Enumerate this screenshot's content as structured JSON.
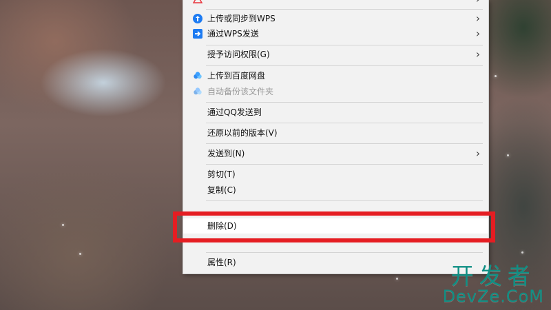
{
  "menu": {
    "items": [
      {
        "id": "top_partial",
        "label": "",
        "icon": "warning-triangle-icon",
        "arrow": true
      },
      {
        "id": "upload_sync_wps",
        "label": "上传或同步到WPS",
        "icon": "cloud-upload-icon",
        "arrow": true
      },
      {
        "id": "send_via_wps",
        "label": "通过WPS发送",
        "icon": "wps-send-icon",
        "arrow": true
      },
      {
        "id": "grant_access",
        "label": "授予访问权限(G)",
        "icon": "",
        "arrow": true
      },
      {
        "id": "upload_baidu",
        "label": "上传到百度网盘",
        "icon": "baidu-cloud-icon",
        "arrow": false
      },
      {
        "id": "auto_backup",
        "label": "自动备份该文件夹",
        "icon": "baidu-cloud-icon",
        "arrow": false
      },
      {
        "id": "send_qq",
        "label": "通过QQ发送到",
        "icon": "",
        "arrow": false
      },
      {
        "id": "restore_previous",
        "label": "还原以前的版本(V)",
        "icon": "",
        "arrow": false
      },
      {
        "id": "send_to",
        "label": "发送到(N)",
        "icon": "",
        "arrow": true
      },
      {
        "id": "cut",
        "label": "剪切(T)",
        "icon": "",
        "arrow": false
      },
      {
        "id": "copy",
        "label": "复制(C)",
        "icon": "",
        "arrow": false
      },
      {
        "id": "create_shortcut",
        "label": "",
        "icon": "",
        "arrow": false
      },
      {
        "id": "delete",
        "label": "删除(D)",
        "icon": "",
        "arrow": false
      },
      {
        "id": "rename",
        "label": "",
        "icon": "",
        "arrow": false
      },
      {
        "id": "properties",
        "label": "属性(R)",
        "icon": "",
        "arrow": false
      }
    ]
  },
  "watermark": {
    "cn": "开发者",
    "en": "DevZe.CoM"
  }
}
